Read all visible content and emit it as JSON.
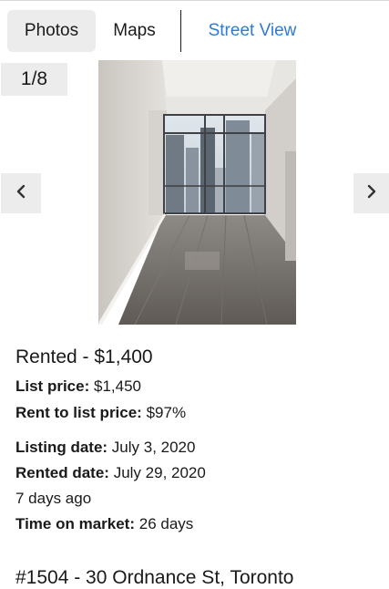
{
  "tabs": {
    "photos": "Photos",
    "maps": "Maps",
    "street_view": "Street View"
  },
  "gallery": {
    "counter": "1/8",
    "prev_icon": "‹",
    "next_icon": "›"
  },
  "listing": {
    "status": "Rented - $1,400",
    "list_price_label": "List price:",
    "list_price_value": "$1,450",
    "ratio_label": "Rent to list price:",
    "ratio_value": "$97%",
    "listing_date_label": "Listing date:",
    "listing_date_value": "July 3, 2020",
    "rented_date_label": "Rented date:",
    "rented_date_value": "July 29, 2020",
    "ago": "7 days ago",
    "tom_label": "Time on market:",
    "tom_value": "26 days",
    "address": "#1504 - 30 Ordnance St, Toronto"
  },
  "colors": {
    "accent": "#2f7bd6",
    "tab_bg": "#ececec"
  }
}
